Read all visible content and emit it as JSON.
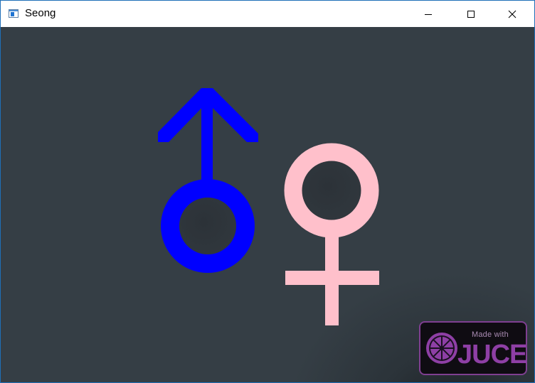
{
  "window": {
    "title": "Seong",
    "icon": "app-window-icon",
    "controls": {
      "minimize": "minimize-icon",
      "maximize": "maximize-icon",
      "close": "close-icon"
    }
  },
  "canvas": {
    "background_color": "#353e45",
    "male_symbol_color": "#0000ff",
    "female_symbol_color": "#ffc0cb"
  },
  "badge": {
    "small_text": "Made with",
    "big_text": "JUCE",
    "accent_color": "#8e3fa5"
  }
}
